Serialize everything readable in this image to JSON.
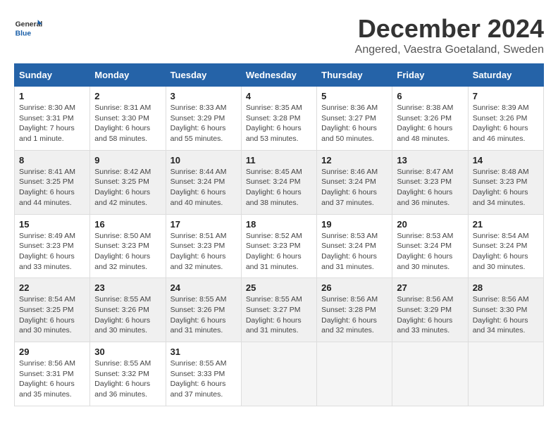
{
  "header": {
    "logo_general": "General",
    "logo_blue": "Blue",
    "month_title": "December 2024",
    "subtitle": "Angered, Vaestra Goetaland, Sweden"
  },
  "weekdays": [
    "Sunday",
    "Monday",
    "Tuesday",
    "Wednesday",
    "Thursday",
    "Friday",
    "Saturday"
  ],
  "weeks": [
    [
      {
        "day": "1",
        "sunrise": "8:30 AM",
        "sunset": "3:31 PM",
        "daylight": "7 hours and 1 minute."
      },
      {
        "day": "2",
        "sunrise": "8:31 AM",
        "sunset": "3:30 PM",
        "daylight": "6 hours and 58 minutes."
      },
      {
        "day": "3",
        "sunrise": "8:33 AM",
        "sunset": "3:29 PM",
        "daylight": "6 hours and 55 minutes."
      },
      {
        "day": "4",
        "sunrise": "8:35 AM",
        "sunset": "3:28 PM",
        "daylight": "6 hours and 53 minutes."
      },
      {
        "day": "5",
        "sunrise": "8:36 AM",
        "sunset": "3:27 PM",
        "daylight": "6 hours and 50 minutes."
      },
      {
        "day": "6",
        "sunrise": "8:38 AM",
        "sunset": "3:26 PM",
        "daylight": "6 hours and 48 minutes."
      },
      {
        "day": "7",
        "sunrise": "8:39 AM",
        "sunset": "3:26 PM",
        "daylight": "6 hours and 46 minutes."
      }
    ],
    [
      {
        "day": "8",
        "sunrise": "8:41 AM",
        "sunset": "3:25 PM",
        "daylight": "6 hours and 44 minutes."
      },
      {
        "day": "9",
        "sunrise": "8:42 AM",
        "sunset": "3:25 PM",
        "daylight": "6 hours and 42 minutes."
      },
      {
        "day": "10",
        "sunrise": "8:44 AM",
        "sunset": "3:24 PM",
        "daylight": "6 hours and 40 minutes."
      },
      {
        "day": "11",
        "sunrise": "8:45 AM",
        "sunset": "3:24 PM",
        "daylight": "6 hours and 38 minutes."
      },
      {
        "day": "12",
        "sunrise": "8:46 AM",
        "sunset": "3:24 PM",
        "daylight": "6 hours and 37 minutes."
      },
      {
        "day": "13",
        "sunrise": "8:47 AM",
        "sunset": "3:23 PM",
        "daylight": "6 hours and 36 minutes."
      },
      {
        "day": "14",
        "sunrise": "8:48 AM",
        "sunset": "3:23 PM",
        "daylight": "6 hours and 34 minutes."
      }
    ],
    [
      {
        "day": "15",
        "sunrise": "8:49 AM",
        "sunset": "3:23 PM",
        "daylight": "6 hours and 33 minutes."
      },
      {
        "day": "16",
        "sunrise": "8:50 AM",
        "sunset": "3:23 PM",
        "daylight": "6 hours and 32 minutes."
      },
      {
        "day": "17",
        "sunrise": "8:51 AM",
        "sunset": "3:23 PM",
        "daylight": "6 hours and 32 minutes."
      },
      {
        "day": "18",
        "sunrise": "8:52 AM",
        "sunset": "3:23 PM",
        "daylight": "6 hours and 31 minutes."
      },
      {
        "day": "19",
        "sunrise": "8:53 AM",
        "sunset": "3:24 PM",
        "daylight": "6 hours and 31 minutes."
      },
      {
        "day": "20",
        "sunrise": "8:53 AM",
        "sunset": "3:24 PM",
        "daylight": "6 hours and 30 minutes."
      },
      {
        "day": "21",
        "sunrise": "8:54 AM",
        "sunset": "3:24 PM",
        "daylight": "6 hours and 30 minutes."
      }
    ],
    [
      {
        "day": "22",
        "sunrise": "8:54 AM",
        "sunset": "3:25 PM",
        "daylight": "6 hours and 30 minutes."
      },
      {
        "day": "23",
        "sunrise": "8:55 AM",
        "sunset": "3:26 PM",
        "daylight": "6 hours and 30 minutes."
      },
      {
        "day": "24",
        "sunrise": "8:55 AM",
        "sunset": "3:26 PM",
        "daylight": "6 hours and 31 minutes."
      },
      {
        "day": "25",
        "sunrise": "8:55 AM",
        "sunset": "3:27 PM",
        "daylight": "6 hours and 31 minutes."
      },
      {
        "day": "26",
        "sunrise": "8:56 AM",
        "sunset": "3:28 PM",
        "daylight": "6 hours and 32 minutes."
      },
      {
        "day": "27",
        "sunrise": "8:56 AM",
        "sunset": "3:29 PM",
        "daylight": "6 hours and 33 minutes."
      },
      {
        "day": "28",
        "sunrise": "8:56 AM",
        "sunset": "3:30 PM",
        "daylight": "6 hours and 34 minutes."
      }
    ],
    [
      {
        "day": "29",
        "sunrise": "8:56 AM",
        "sunset": "3:31 PM",
        "daylight": "6 hours and 35 minutes."
      },
      {
        "day": "30",
        "sunrise": "8:55 AM",
        "sunset": "3:32 PM",
        "daylight": "6 hours and 36 minutes."
      },
      {
        "day": "31",
        "sunrise": "8:55 AM",
        "sunset": "3:33 PM",
        "daylight": "6 hours and 37 minutes."
      },
      null,
      null,
      null,
      null
    ]
  ]
}
